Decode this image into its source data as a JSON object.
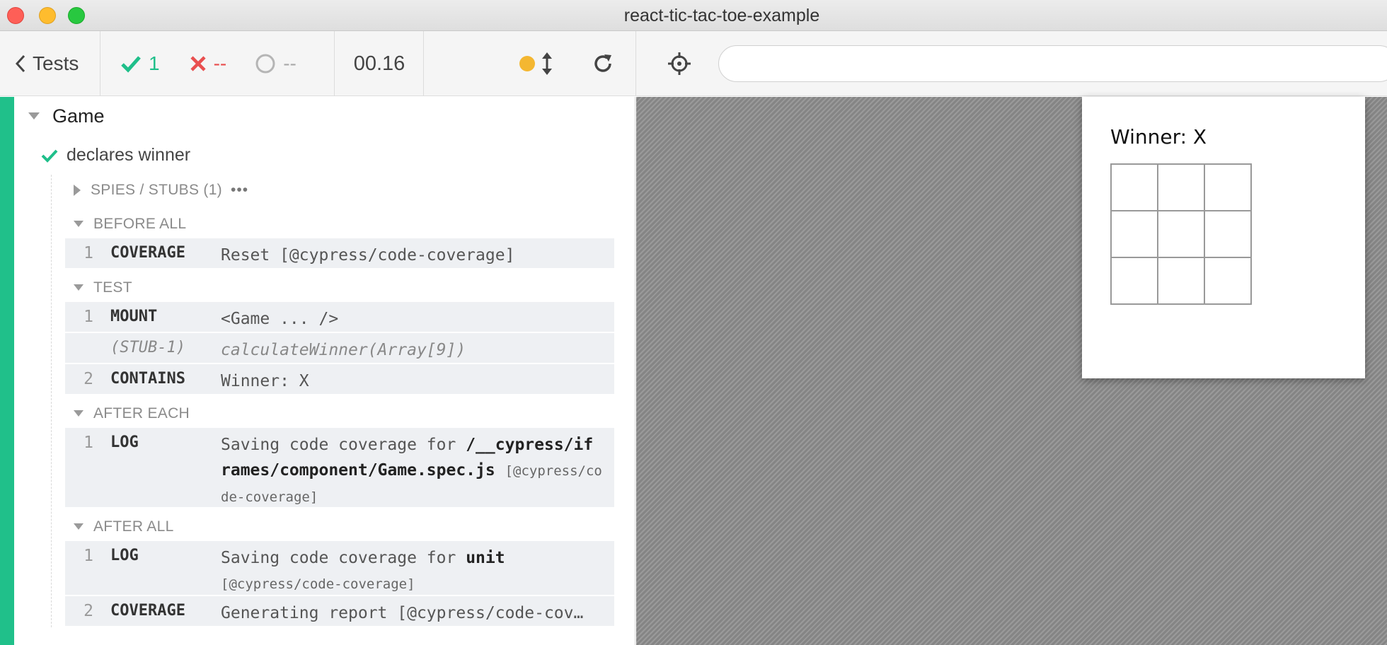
{
  "window": {
    "title": "react-tic-tac-toe-example"
  },
  "toolbar": {
    "back_label": "Tests",
    "passed": "1",
    "failed": "--",
    "pending": "--",
    "duration": "00.16",
    "url_value": ""
  },
  "reporter": {
    "suite": "Game",
    "test": "declares winner",
    "spies": {
      "label": "SPIES / STUBS (1)",
      "more": "•••"
    },
    "hooks": {
      "before_all": {
        "label": "BEFORE ALL",
        "commands": [
          {
            "num": "1",
            "name": "COVERAGE",
            "msg": "Reset [@cypress/code-coverage]"
          }
        ]
      },
      "test": {
        "label": "TEST",
        "commands": [
          {
            "num": "1",
            "name": "MOUNT",
            "msg": "<Game ... />"
          },
          {
            "num": "",
            "name": "(STUB-1)",
            "msg": "calculateWinner(Array[9])"
          },
          {
            "num": "2",
            "name": "CONTAINS",
            "msg": "Winner: X"
          }
        ]
      },
      "after_each": {
        "label": "AFTER EACH",
        "commands": [
          {
            "num": "1",
            "name": "LOG",
            "msg_prefix": "Saving code coverage for",
            "msg_bold": "/__cypress/iframes/component/Game.spec.js",
            "msg_suffix": "[@cypress/code-coverage]"
          }
        ]
      },
      "after_all": {
        "label": "AFTER ALL",
        "commands": [
          {
            "num": "1",
            "name": "LOG",
            "msg_prefix": "Saving code coverage for",
            "msg_bold": "unit",
            "msg_suffix": "[@cypress/code-coverage]"
          },
          {
            "num": "2",
            "name": "COVERAGE",
            "msg": "Generating report [@cypress/code-cov…"
          }
        ]
      }
    }
  },
  "app": {
    "status": "Winner: X"
  },
  "colors": {
    "passed": "#1fbf8a",
    "failed": "#e94f4f",
    "running_dot": "#f4b731"
  }
}
